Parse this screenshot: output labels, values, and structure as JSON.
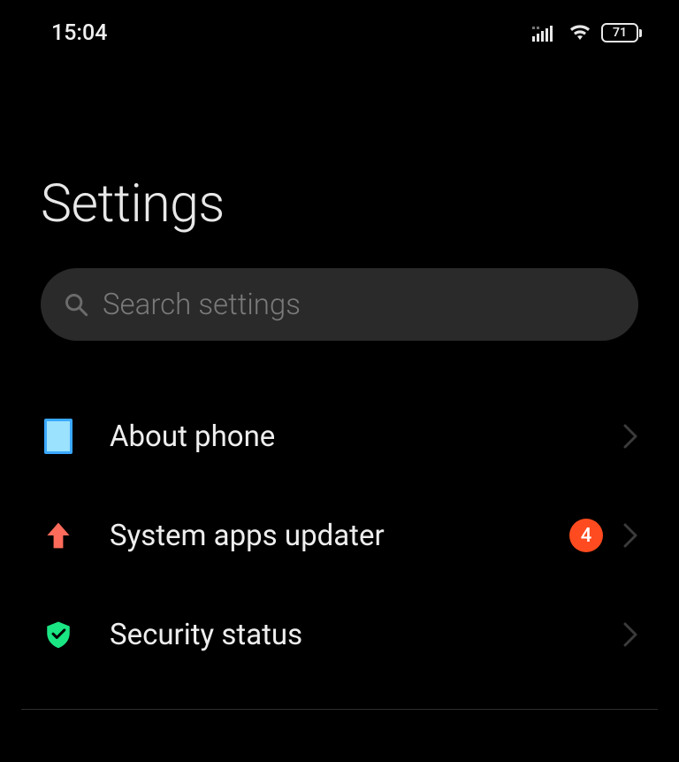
{
  "status_bar": {
    "time": "15:04",
    "battery": "71"
  },
  "page": {
    "title": "Settings"
  },
  "search": {
    "placeholder": "Search settings"
  },
  "items": [
    {
      "label": "About phone",
      "badge": null
    },
    {
      "label": "System apps updater",
      "badge": "4"
    },
    {
      "label": "Security status",
      "badge": null
    }
  ]
}
